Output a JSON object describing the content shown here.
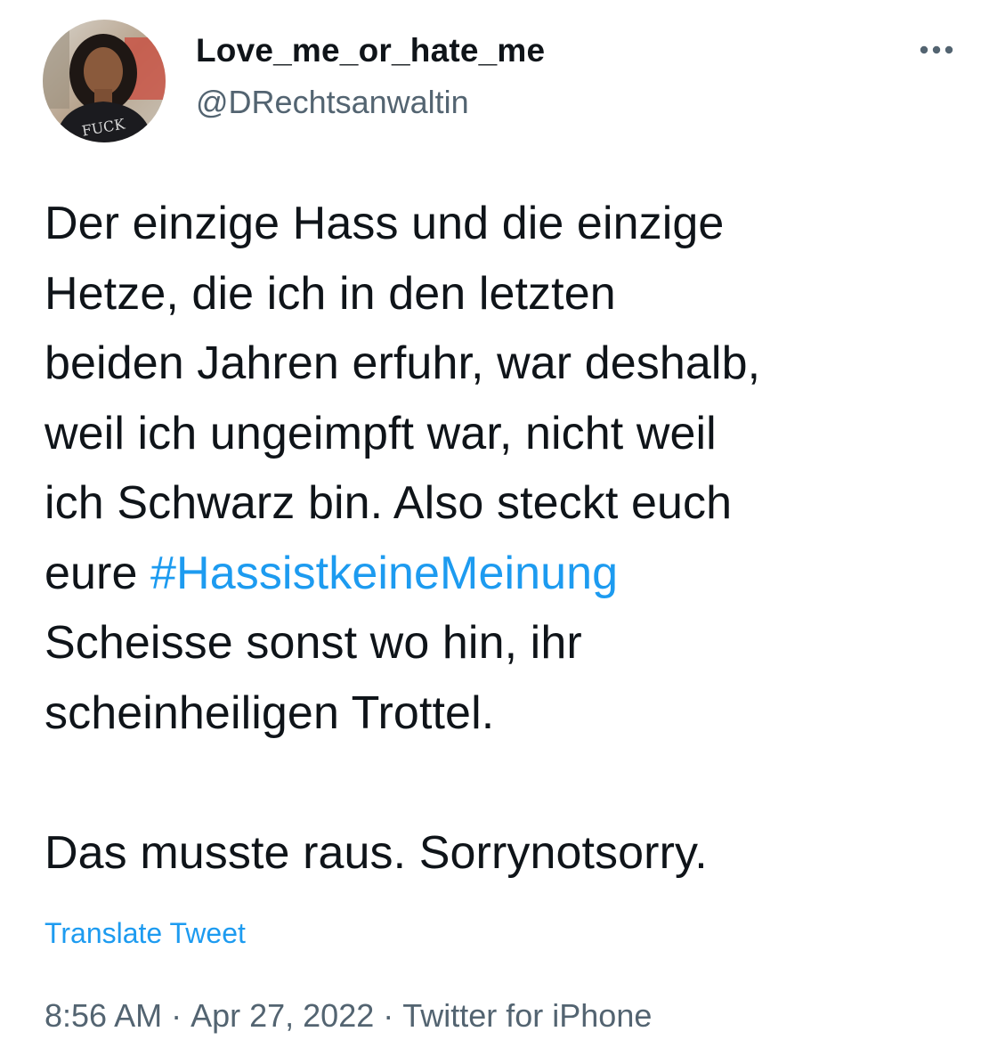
{
  "author": {
    "display_name": "Love_me_or_hate_me",
    "handle": "@DRechtsanwaltin",
    "avatar_shirt_text": "FUCK"
  },
  "more_icon": "more-horizontal-icon",
  "tweet": {
    "lines": [
      "Der einzige Hass und die einzige",
      "Hetze, die ich in den letzten",
      "beiden Jahren erfuhr, war deshalb,",
      "weil ich ungeimpft war, nicht weil",
      "ich Schwarz bin. Also steckt euch"
    ],
    "line6_prefix": "eure ",
    "hashtag": "#HassistkeineMeinung",
    "lines_after": [
      "Scheisse sonst wo hin, ihr",
      "scheinheiligen Trottel."
    ],
    "final_line": "Das musste raus. Sorrynotsorry."
  },
  "translate_label": "Translate Tweet",
  "meta": {
    "time": "8:56 AM",
    "date": "Apr 27, 2022",
    "source": "Twitter for iPhone",
    "separator": "·"
  },
  "colors": {
    "link": "#1d9bf0",
    "secondary_text": "#536471",
    "primary_text": "#0f1419"
  }
}
